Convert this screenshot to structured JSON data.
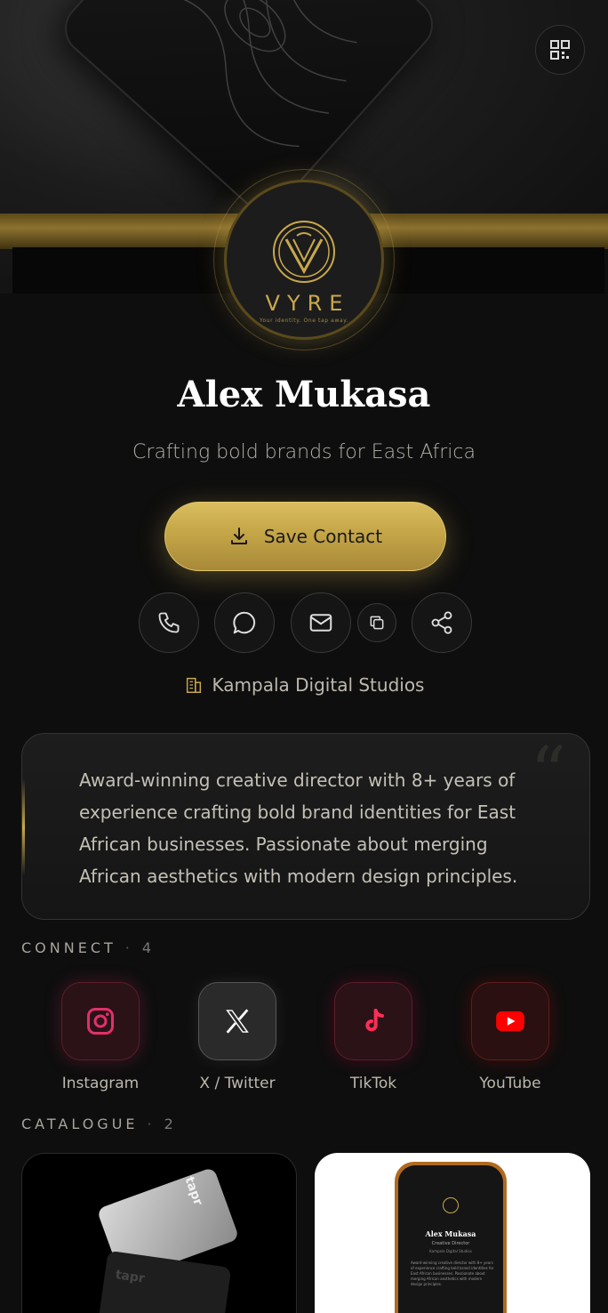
{
  "brand": {
    "logo_word": "VYRE",
    "logo_tagline": "Your identity. One tap away."
  },
  "profile": {
    "name": "Alex Mukasa",
    "tagline": "Crafting bold brands for East Africa",
    "company": "Kampala Digital Studios",
    "bio": "Award-winning creative director with 8+ years of experience crafting bold brand identities for East African businesses. Passionate about merging African aesthetics with modern design principles."
  },
  "actions": {
    "save_contact": "Save Contact"
  },
  "connect": {
    "label": "CONNECT",
    "count": "4",
    "items": [
      {
        "label": "Instagram",
        "icon": "instagram-icon",
        "color": "#e1306c"
      },
      {
        "label": "X / Twitter",
        "icon": "x-twitter-icon",
        "color": "#ffffff"
      },
      {
        "label": "TikTok",
        "icon": "tiktok-icon",
        "color": "#ff2d55"
      },
      {
        "label": "YouTube",
        "icon": "youtube-icon",
        "color": "#ff0000"
      }
    ]
  },
  "catalogue": {
    "label": "CATALOGUE",
    "count": "2",
    "items": [
      {
        "card_brand": "tapr"
      },
      {
        "preview_name": "Alex Mukasa",
        "preview_role": "Creative Director",
        "preview_company": "Kampala Digital Studios",
        "preview_bio": "Award-winning creative director with 8+ years of experience crafting bold brand identities for East African businesses. Passionate about merging African aesthetics with modern design principles."
      }
    ]
  },
  "colors": {
    "accent_gold": "#c9a84c",
    "background": "#0e0e0e"
  }
}
